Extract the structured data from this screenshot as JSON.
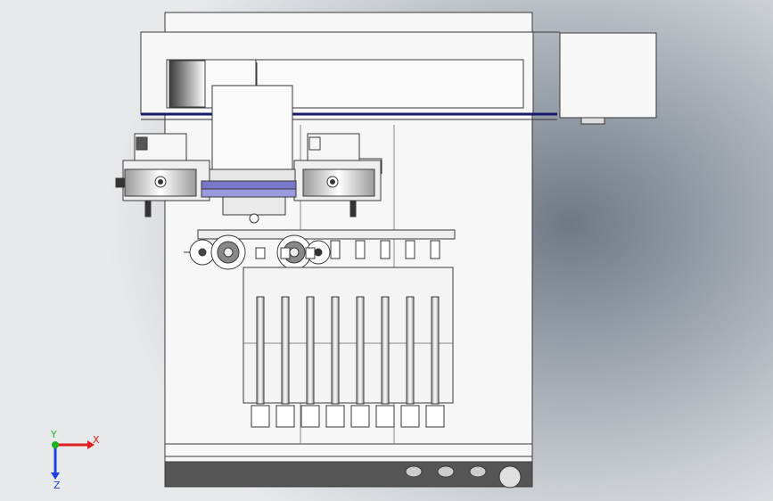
{
  "view": {
    "triad": {
      "x_label": "X",
      "y_label": "Y",
      "z_label": "Z",
      "x_color": "#e02020",
      "y_color": "#20b020",
      "z_color": "#2040e0"
    },
    "colors": {
      "body": "#f4f4f4",
      "stroke": "#3a3a3a",
      "accent": "#7878c8",
      "base": "#555555"
    },
    "syringe_count": 8,
    "knob_count": 4
  }
}
